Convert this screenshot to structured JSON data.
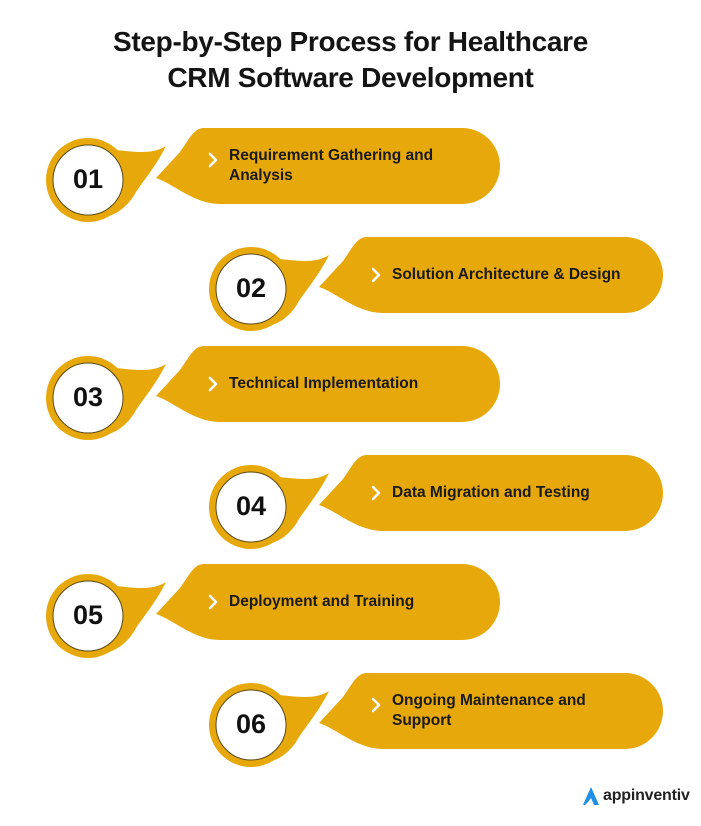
{
  "title": {
    "line1": "Step-by-Step Process for Healthcare",
    "line2": "CRM Software Development"
  },
  "colors": {
    "accent": "#e6a80a",
    "circle_border": "#5a4a1a",
    "chevron": "#ffffff"
  },
  "steps": [
    {
      "number": "01",
      "line1": "Requirement Gathering and",
      "line2": "Analysis"
    },
    {
      "number": "02",
      "line1": "Solution Architecture & Design",
      "line2": ""
    },
    {
      "number": "03",
      "line1": "Technical Implementation",
      "line2": ""
    },
    {
      "number": "04",
      "line1": "Data Migration and Testing",
      "line2": ""
    },
    {
      "number": "05",
      "line1": "Deployment and Training",
      "line2": ""
    },
    {
      "number": "06",
      "line1": "Ongoing Maintenance and",
      "line2": "Support"
    }
  ],
  "brand": {
    "name": "appinventiv",
    "icon": "appinventiv-logo-icon"
  }
}
